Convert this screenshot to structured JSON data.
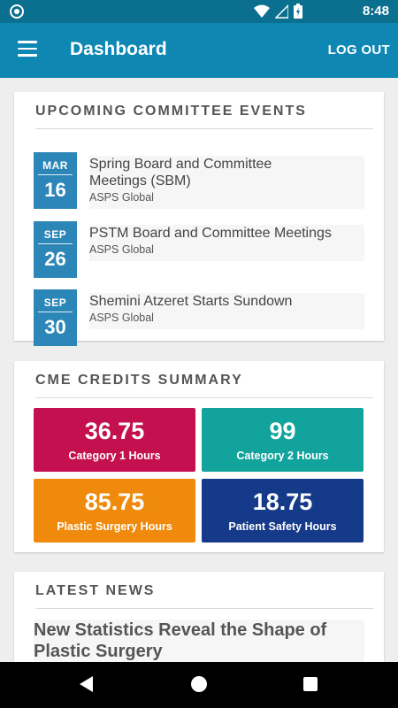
{
  "status_bar": {
    "time": "8:48"
  },
  "app_bar": {
    "title": "Dashboard",
    "logout_label": "LOG OUT"
  },
  "events": {
    "heading": "UPCOMING COMMITTEE EVENTS",
    "items": [
      {
        "month": "MAR",
        "day": "16",
        "title_line1": "Spring Board and Committee",
        "title_line2": "Meetings (SBM)",
        "org": "ASPS Global"
      },
      {
        "month": "SEP",
        "day": "26",
        "title_line1": "PSTM Board and Committee Meetings",
        "title_line2": "",
        "org": "ASPS Global"
      },
      {
        "month": "SEP",
        "day": "30",
        "title_line1": "Shemini Atzeret Starts Sundown",
        "title_line2": "",
        "org": "ASPS Global"
      }
    ]
  },
  "cme": {
    "heading": "CME CREDITS SUMMARY",
    "tiles": [
      {
        "value": "36.75",
        "label": "Category 1 Hours",
        "color": "#c4104e"
      },
      {
        "value": "99",
        "label": "Category 2 Hours",
        "color": "#12a39c"
      },
      {
        "value": "85.75",
        "label": "Plastic Surgery Hours",
        "color": "#f08a0c"
      },
      {
        "value": "18.75",
        "label": "Patient Safety Hours",
        "color": "#163a8a"
      }
    ]
  },
  "news": {
    "heading": "LATEST NEWS",
    "items": [
      {
        "title_line1": "New Statistics Reveal the Shape of",
        "title_line2": "Plastic Surgery"
      }
    ]
  }
}
